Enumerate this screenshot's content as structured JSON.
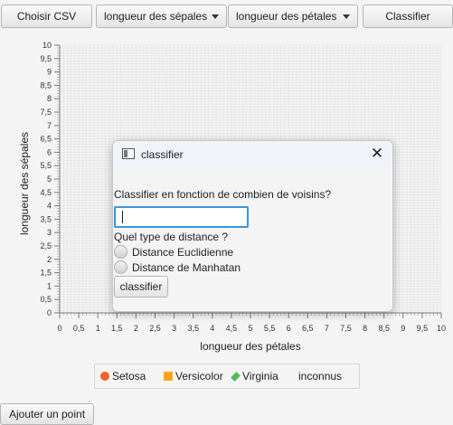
{
  "toolbar": {
    "choose_csv": "Choisir CSV",
    "x_axis_select": "longueur des sépales",
    "y_axis_select": "longueur des pétales",
    "classify": "Classifier"
  },
  "chart_data": {
    "type": "scatter",
    "xlabel": "longueur des pétales",
    "ylabel": "longueur des sépales",
    "xlim": [
      0,
      10
    ],
    "ylim": [
      0,
      10
    ],
    "tick_step": 0.5,
    "x_ticks": [
      "0",
      "0,5",
      "1",
      "1,5",
      "2",
      "2,5",
      "3",
      "3,5",
      "4",
      "4,5",
      "5",
      "5,5",
      "6",
      "6,5",
      "7",
      "7,5",
      "8",
      "8,5",
      "9",
      "9,5",
      "10"
    ],
    "y_ticks": [
      "0",
      "0,5",
      "1",
      "1,5",
      "2",
      "2,5",
      "3",
      "3,5",
      "4",
      "4,5",
      "5",
      "5,5",
      "6",
      "6,5",
      "7",
      "7,5",
      "8",
      "8,5",
      "9",
      "9,5",
      "10"
    ],
    "grid": true,
    "series": [
      {
        "name": "Setosa",
        "points": []
      },
      {
        "name": "Versicolor",
        "points": []
      },
      {
        "name": "Virginia",
        "points": []
      },
      {
        "name": "inconnus",
        "points": []
      }
    ],
    "legend_position": "bottom"
  },
  "legend": {
    "setosa": "Setosa",
    "versicolor": "Versicolor",
    "virginia": "Virginia",
    "unknown": "inconnus"
  },
  "colors": {
    "setosa": "#f3622d",
    "versicolor": "#fba71b",
    "virginia": "#57b757",
    "focus": "#3a95dc"
  },
  "dialog": {
    "title": "classifier",
    "close_icon": "close-icon",
    "neighbors_question": "Classifier en fonction de combien de voisins?",
    "neighbors_value": "",
    "distance_question": "Quel type de distance ?",
    "distance_options": [
      "Distance Euclidienne",
      "Distance de Manhatan"
    ],
    "submit": "classifier"
  },
  "bottom": {
    "add_point": "Ajouter un point"
  }
}
